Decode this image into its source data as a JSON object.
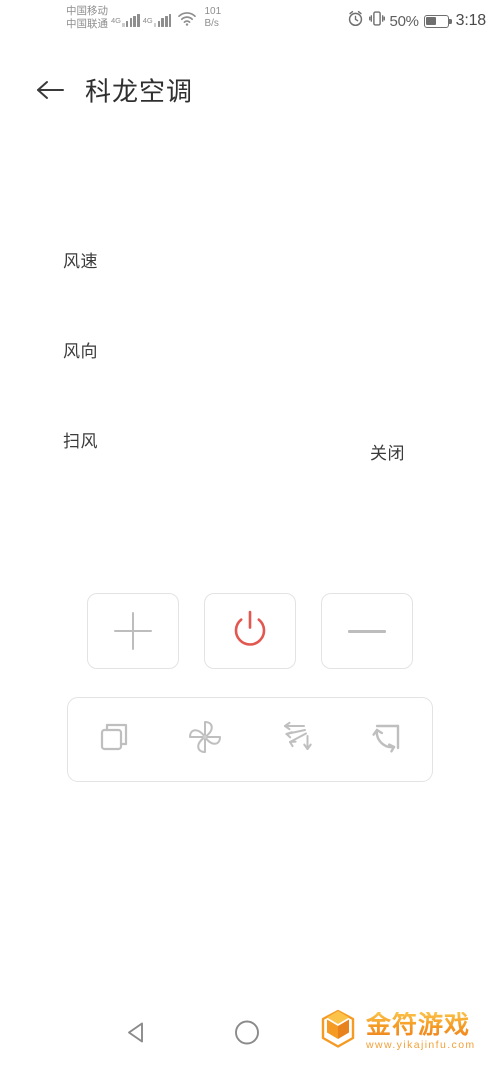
{
  "statusbar": {
    "carrier_primary": "中国移动",
    "carrier_secondary": "中国联通",
    "network_primary": "4G",
    "network_secondary": "4G",
    "data_speed_value": "101",
    "data_speed_unit": "B/s",
    "alarm_icon": "alarm-clock-icon",
    "vibrate_icon": "vibrate-icon",
    "wifi_icon": "wifi-icon",
    "battery_percent": "50%",
    "battery_level": 50,
    "clock": "3:18"
  },
  "appbar": {
    "back_icon": "back-arrow-icon",
    "title": "科龙空调"
  },
  "settings": {
    "rows": [
      {
        "label": "风速",
        "value": ""
      },
      {
        "label": "风向",
        "value": ""
      },
      {
        "label": "扫风",
        "value": "关闭"
      }
    ]
  },
  "controls": {
    "increase_label": "+",
    "power_label": "power",
    "decrease_label": "−",
    "power_color": "#e2574f",
    "glyph_color": "#bdbdbd",
    "border_color": "#e3e3e3"
  },
  "mode_bar": {
    "buttons": [
      {
        "icon": "mode-squares-icon",
        "name": "模式"
      },
      {
        "icon": "fan-pinwheel-icon",
        "name": "风速"
      },
      {
        "icon": "swing-arrows-icon",
        "name": "扫风"
      },
      {
        "icon": "rotate-loop-icon",
        "name": "循环"
      }
    ]
  },
  "watermark": {
    "logo_icon": "cube-logo-icon",
    "title": "金符游戏",
    "url": "www.yikajinfu.com",
    "color": "#f59a23"
  },
  "navbar": {
    "back_icon": "nav-back-triangle-icon",
    "home_icon": "nav-home-circle-icon"
  }
}
